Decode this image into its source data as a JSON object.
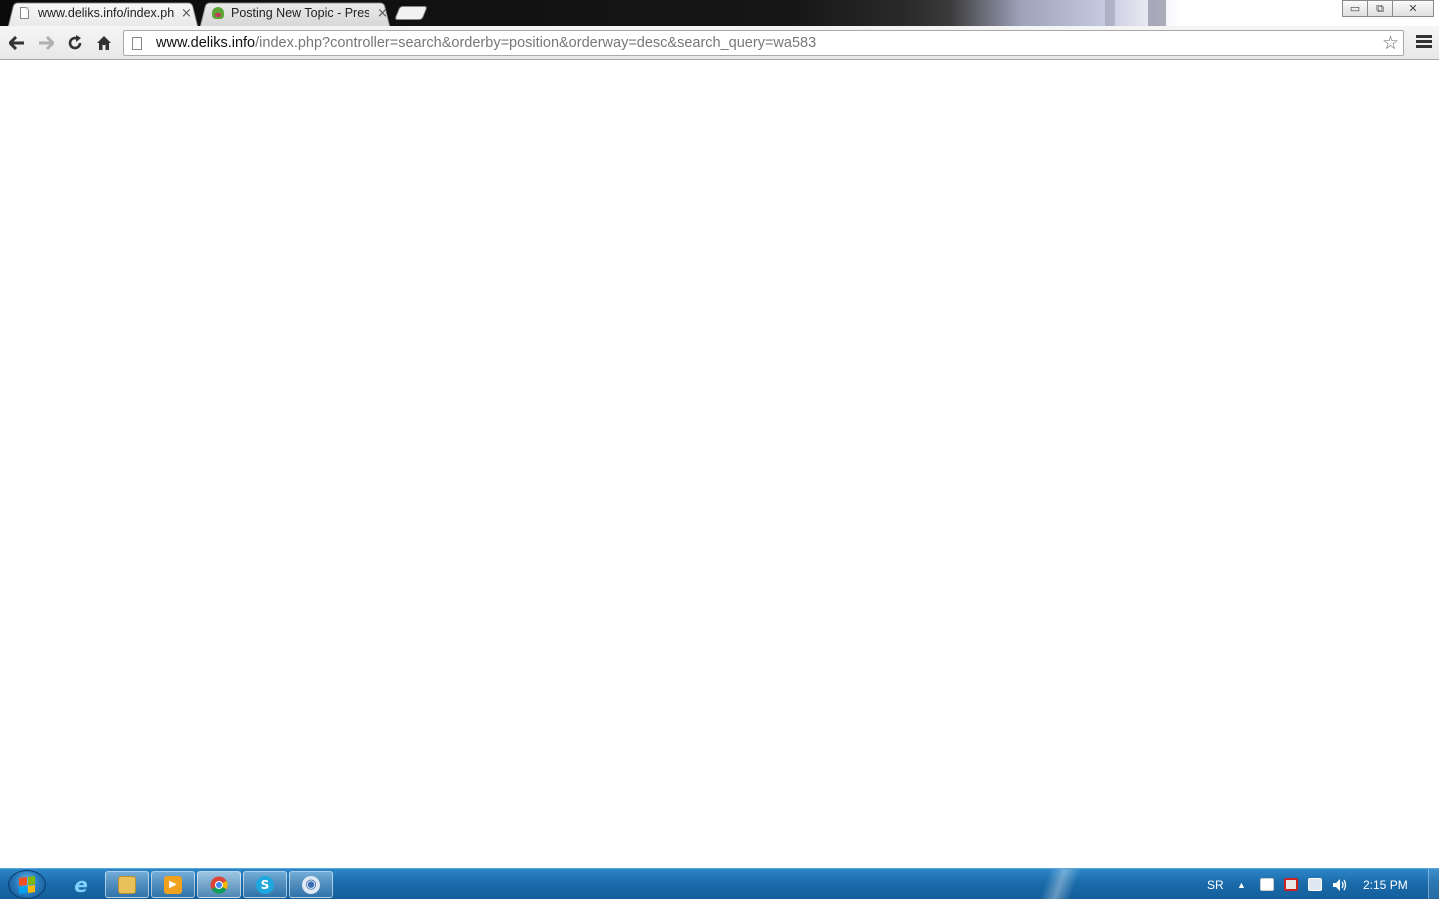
{
  "browser": {
    "tabs": [
      {
        "title": "www.deliks.info/index.php",
        "close": "×",
        "active": true,
        "icon": "page-icon"
      },
      {
        "title": "Posting New Topic - Prest",
        "close": "×",
        "active": false,
        "icon": "prestashop-frog-icon"
      }
    ],
    "window_controls": {
      "minimize": "▭",
      "maximize": "⧉",
      "close": "✕"
    },
    "toolbar": {
      "back": "🡐",
      "forward": "🡒",
      "reload": "↻",
      "home": "⌂",
      "url_host": "www.deliks.info",
      "url_rest": "/index.php?controller=search&orderby=position&orderway=desc&search_query=wa583",
      "bookmark_star": "☆"
    }
  },
  "taskbar": {
    "pinned": [
      {
        "name": "internet-explorer",
        "glyph": "e",
        "color": "#3a8fd6"
      },
      {
        "name": "windows-explorer",
        "glyph": "",
        "color": "#e9c15a"
      },
      {
        "name": "media-player",
        "glyph": "▶",
        "color": "#f0a21f"
      },
      {
        "name": "chrome",
        "glyph": "",
        "color": "#d94a3c"
      },
      {
        "name": "skype",
        "glyph": "S",
        "color": "#1fa8e0"
      },
      {
        "name": "app-globe",
        "glyph": "◉",
        "color": "#3b6fb5"
      }
    ],
    "language": "SR",
    "show_hidden": "▲",
    "clock": "2:15 PM"
  }
}
